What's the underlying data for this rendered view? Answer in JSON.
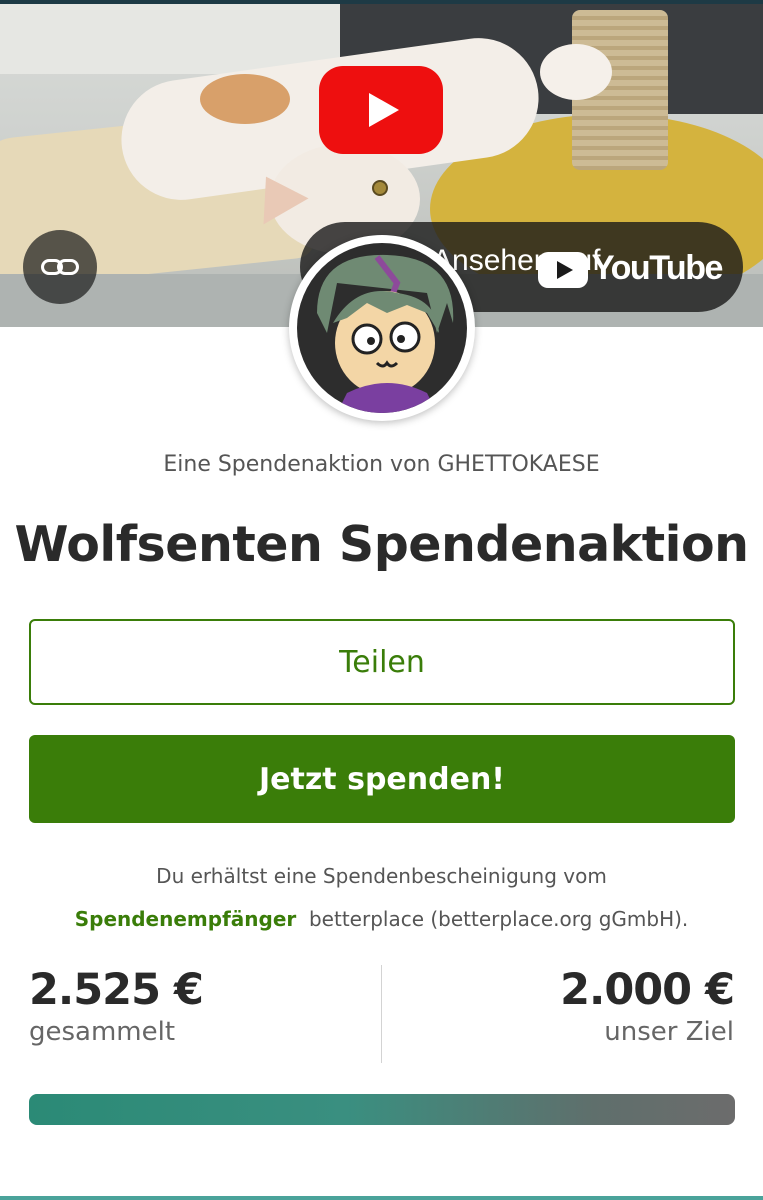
{
  "video": {
    "watch_on": "Ansehen auf",
    "platform": "YouTube",
    "play_icon": "play-icon",
    "link_icon": "link-icon"
  },
  "campaign": {
    "byline": "Eine Spendenaktion von GHETTOKAESE",
    "title": "Wolfsenten Spendenaktion"
  },
  "actions": {
    "share_label": "Teilen",
    "donate_label": "Jetzt spenden!"
  },
  "receipt": {
    "text_before": "Du erhältst eine Spendenbescheinigung vom",
    "link_text": "Spendenempfänger",
    "text_after": "betterplace (betterplace.org gGmbH)."
  },
  "stats": {
    "raised_value": "2.525 €",
    "raised_label": "gesammelt",
    "goal_value": "2.000 €",
    "goal_label": "unser Ziel"
  },
  "progress": {
    "fraction": 1.0
  },
  "colors": {
    "accent": "#3a7d09",
    "youtube_red": "#ee0f0f",
    "progress_start": "#2b8a76",
    "progress_end": "#6c6c6c"
  }
}
